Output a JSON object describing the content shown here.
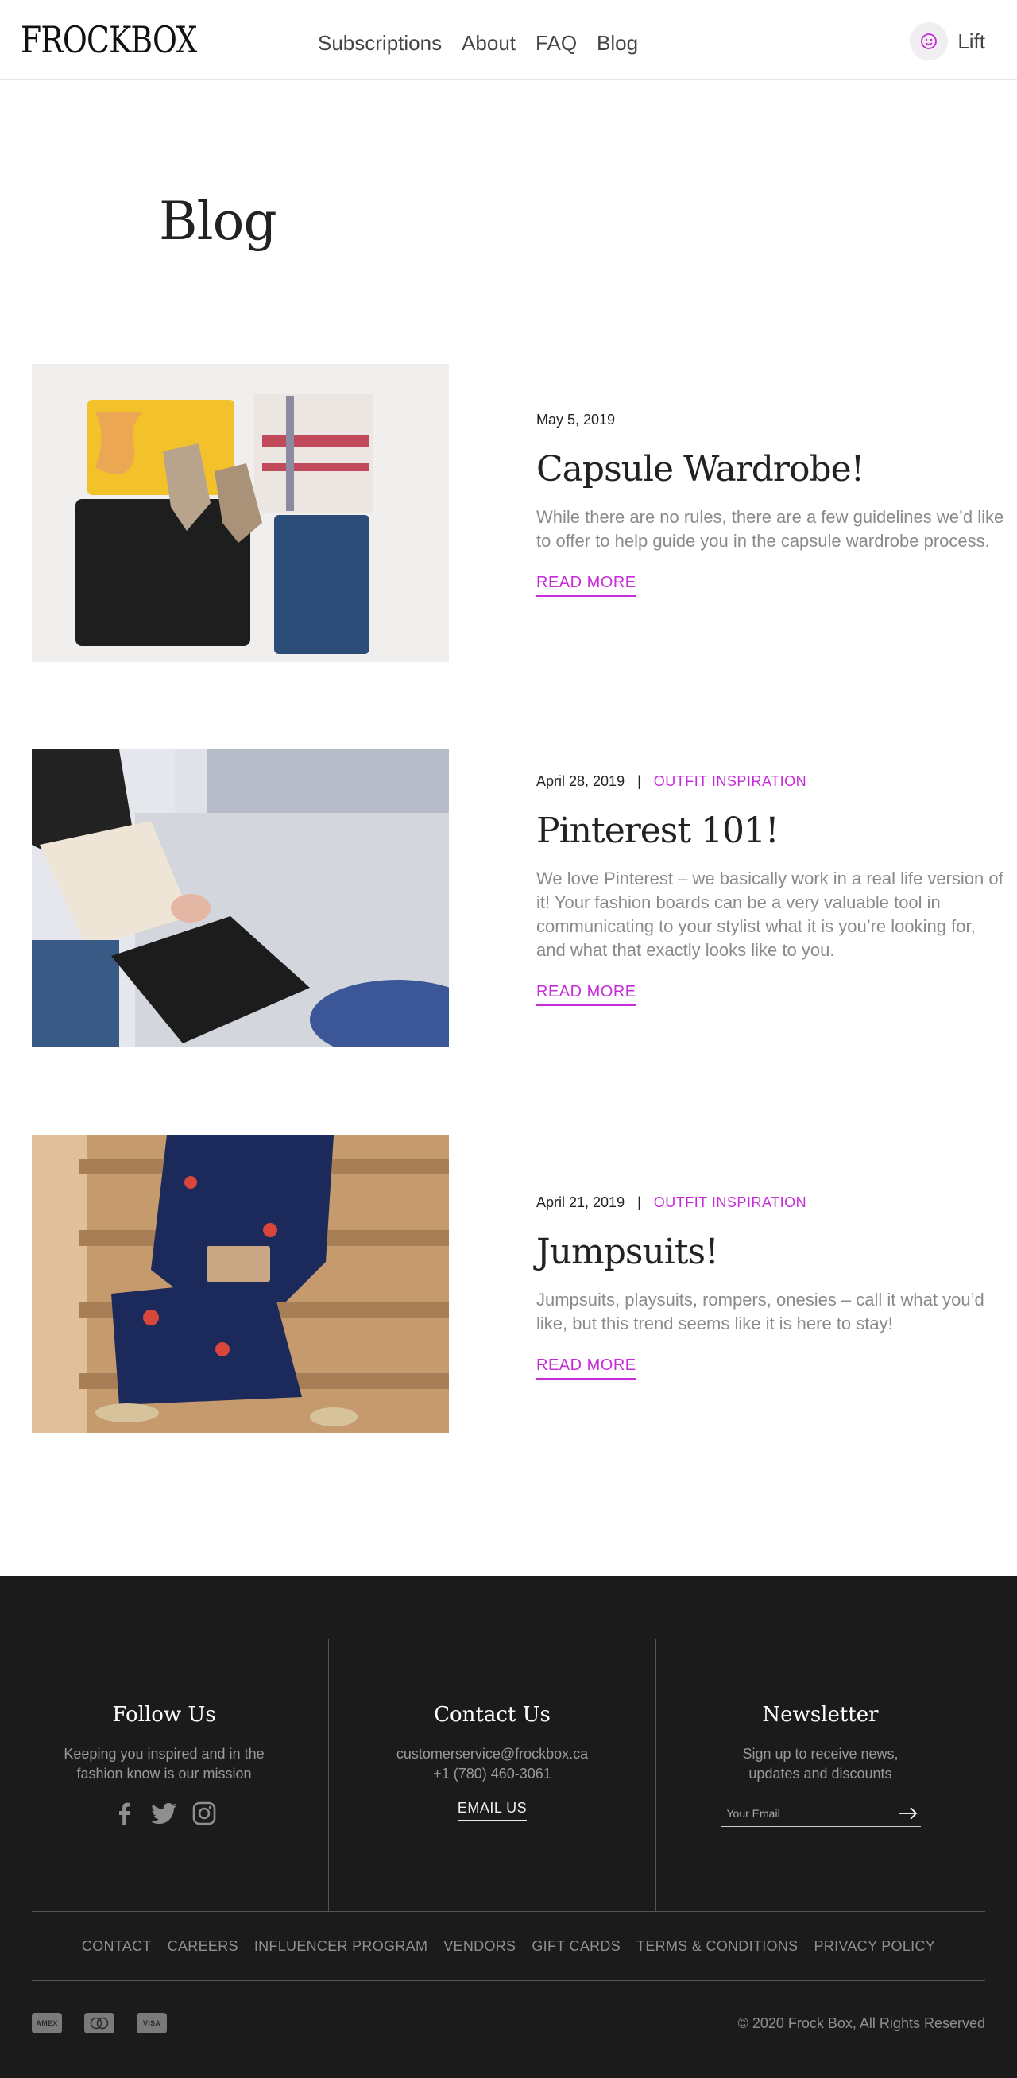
{
  "header": {
    "logo": "FROCKBOX",
    "nav": [
      "Subscriptions",
      "About",
      "FAQ",
      "Blog"
    ],
    "account_name": "Lift",
    "accent_color": "#c62bd8"
  },
  "page": {
    "title": "Blog"
  },
  "posts": [
    {
      "date": "May 5, 2019",
      "category": "",
      "title": "Capsule Wardrobe!",
      "excerpt": "While there are no rules, there are a few guidelines we’d like to offer to help guide you in the capsule wardrobe process.",
      "read_more": "READ MORE"
    },
    {
      "date": "April 28, 2019",
      "separator": "|",
      "category": "OUTFIT INSPIRATION",
      "title": "Pinterest 101!",
      "excerpt": "We love Pinterest – we basically work in a real life version of it! Your fashion boards can be a very valuable tool in communicating to your stylist what it is you’re looking for, and what that exactly looks like to you.",
      "read_more": "READ MORE"
    },
    {
      "date": "April 21, 2019",
      "separator": "|",
      "category": "OUTFIT INSPIRATION",
      "title": "Jumpsuits!",
      "excerpt": "Jumpsuits, playsuits, rompers, onesies – call it what you’d like, but this trend seems like it is here to stay!",
      "read_more": "READ MORE"
    }
  ],
  "footer": {
    "follow": {
      "title": "Follow Us",
      "text": "Keeping you inspired and in the fashion know is our mission",
      "socials": [
        "facebook-icon",
        "twitter-icon",
        "instagram-icon"
      ]
    },
    "contact": {
      "title": "Contact Us",
      "email": "customerservice@frockbox.ca",
      "phone": "+1 (780) 460-3061",
      "email_us": "EMAIL US"
    },
    "newsletter": {
      "title": "Newsletter",
      "text": "Sign up to receive news, updates and discounts",
      "placeholder": "Your Email"
    },
    "links": [
      "CONTACT",
      "CAREERS",
      "INFLUENCER PROGRAM",
      "VENDORS",
      "GIFT CARDS",
      "TERMS & CONDITIONS",
      "PRIVACY POLICY"
    ],
    "payments": [
      "AMEX",
      "mastercard",
      "VISA"
    ],
    "copyright": "© 2020 Frock Box, All Rights Reserved"
  }
}
